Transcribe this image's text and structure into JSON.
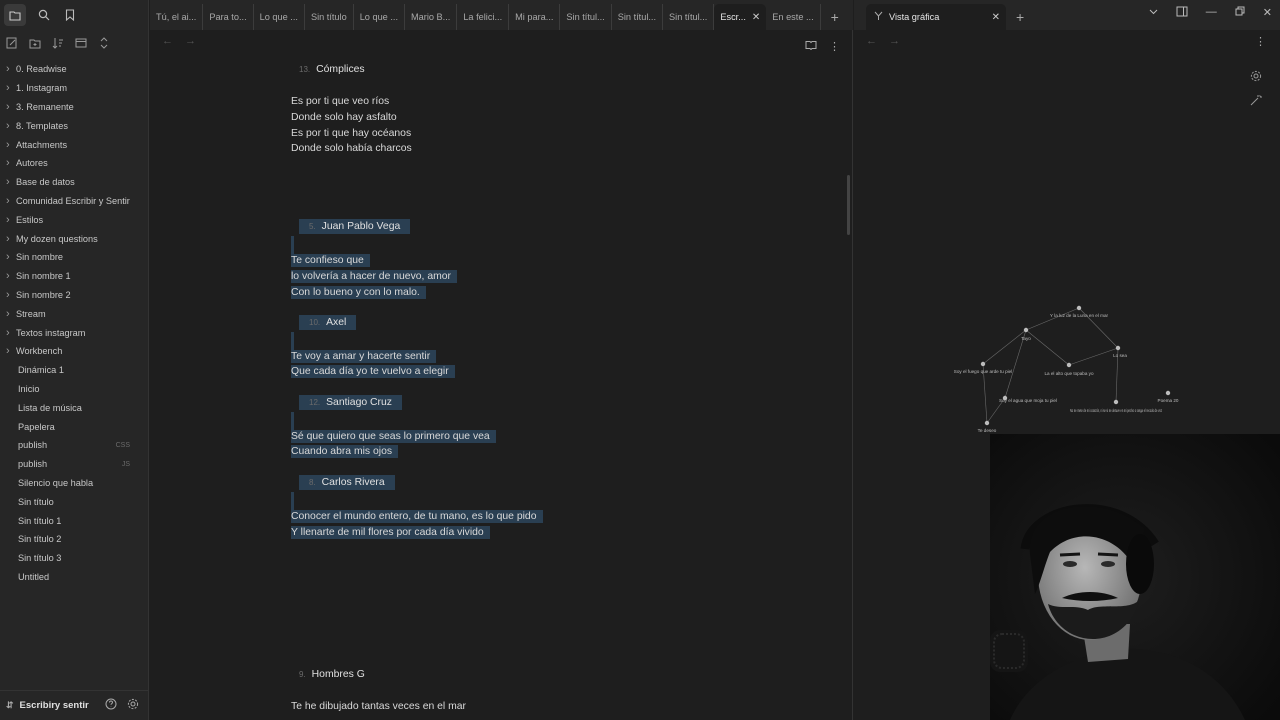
{
  "sidebar": {
    "top_icons": [
      "folder-icon",
      "search-icon",
      "bookmark-icon"
    ],
    "file_actions": [
      "new-note-icon",
      "new-folder-icon",
      "sort-icon",
      "collapse-icon",
      "expand-icon"
    ],
    "items": [
      {
        "label": "0. Readwise",
        "folder": true
      },
      {
        "label": "1. Instagram",
        "folder": true
      },
      {
        "label": "3. Remanente",
        "folder": true
      },
      {
        "label": "8. Templates",
        "folder": true
      },
      {
        "label": "Attachments",
        "folder": true
      },
      {
        "label": "Autores",
        "folder": true
      },
      {
        "label": "Base de datos",
        "folder": true
      },
      {
        "label": "Comunidad Escribir y Sentir",
        "folder": true
      },
      {
        "label": "Estilos",
        "folder": true
      },
      {
        "label": "My dozen questions",
        "folder": true
      },
      {
        "label": "Sin nombre",
        "folder": true
      },
      {
        "label": "Sin nombre 1",
        "folder": true
      },
      {
        "label": "Sin nombre 2",
        "folder": true
      },
      {
        "label": "Stream",
        "folder": true
      },
      {
        "label": "Textos instagram",
        "folder": true
      },
      {
        "label": "Workbench",
        "folder": true
      },
      {
        "label": "Dinámica 1",
        "folder": false
      },
      {
        "label": "Inicio",
        "folder": false
      },
      {
        "label": "Lista de música",
        "folder": false
      },
      {
        "label": "Papelera",
        "folder": false
      },
      {
        "label": "publish",
        "folder": false,
        "tag": "CSS"
      },
      {
        "label": "publish",
        "folder": false,
        "tag": "JS"
      },
      {
        "label": "Silencio que habla",
        "folder": false
      },
      {
        "label": "Sin título",
        "folder": false
      },
      {
        "label": "Sin título 1",
        "folder": false
      },
      {
        "label": "Sin título 2",
        "folder": false
      },
      {
        "label": "Sin título 3",
        "folder": false
      },
      {
        "label": "Untitled",
        "folder": false
      }
    ],
    "vault_name": "Escribiry sentir"
  },
  "tabs": [
    {
      "label": "Tú, el ai..."
    },
    {
      "label": "Para to..."
    },
    {
      "label": "Lo que ..."
    },
    {
      "label": "Sin título"
    },
    {
      "label": "Lo que ..."
    },
    {
      "label": "Mario B..."
    },
    {
      "label": "La felici..."
    },
    {
      "label": "Mi para..."
    },
    {
      "label": "Sin títul..."
    },
    {
      "label": "Sin títul..."
    },
    {
      "label": "Sin títul..."
    },
    {
      "label": "Escr...",
      "active": true
    },
    {
      "label": "En este ..."
    }
  ],
  "editor": {
    "sections": [
      {
        "num": "13.",
        "title": "Cómplices",
        "lines": [
          "Es por ti que veo ríos",
          "Donde solo hay asfalto",
          "Es por ti que hay océanos",
          "Donde solo había charcos"
        ]
      },
      {
        "num": "5.",
        "title": "Juan Pablo Vega",
        "lines": [
          "Te confieso que",
          "lo volvería a hacer de nuevo, amor",
          "Con lo bueno y con lo malo."
        ]
      },
      {
        "num": "10.",
        "title": "Axel",
        "lines": [
          "Te voy a amar y hacerte sentir",
          "Que cada día yo te vuelvo a elegir"
        ]
      },
      {
        "num": "12.",
        "title": "Santiago Cruz",
        "lines": [
          "Sé que quiero que seas lo primero que vea",
          "Cuando abra mis ojos"
        ]
      },
      {
        "num": "8.",
        "title": "Carlos Rivera",
        "lines": [
          "Conocer el mundo entero, de tu mano, es lo que pido",
          "Y llenarte de mil flores por cada día vivido"
        ]
      },
      {
        "num": "9.",
        "title": "Hombres G",
        "lines": [
          "Te he dibujado tantas veces en el mar"
        ]
      }
    ]
  },
  "graph_tab": {
    "label": "Vista gráfica"
  },
  "graph": {
    "nodes": [
      {
        "label": "Y la luz de la Luna en el mar"
      },
      {
        "label": "Tayo"
      },
      {
        "label": "Lo sea"
      },
      {
        "label": "Soy el fuego que arde tu piel"
      },
      {
        "label": "La el alto que topaba yo"
      },
      {
        "label": "Soy el agua que moja tu piel"
      },
      {
        "label": "No se mete de mi corazón, ni se si se detuve en mi pecho o rasga el recodo de voz"
      },
      {
        "label": "Poema 20"
      },
      {
        "label": "Te deseo"
      }
    ]
  }
}
